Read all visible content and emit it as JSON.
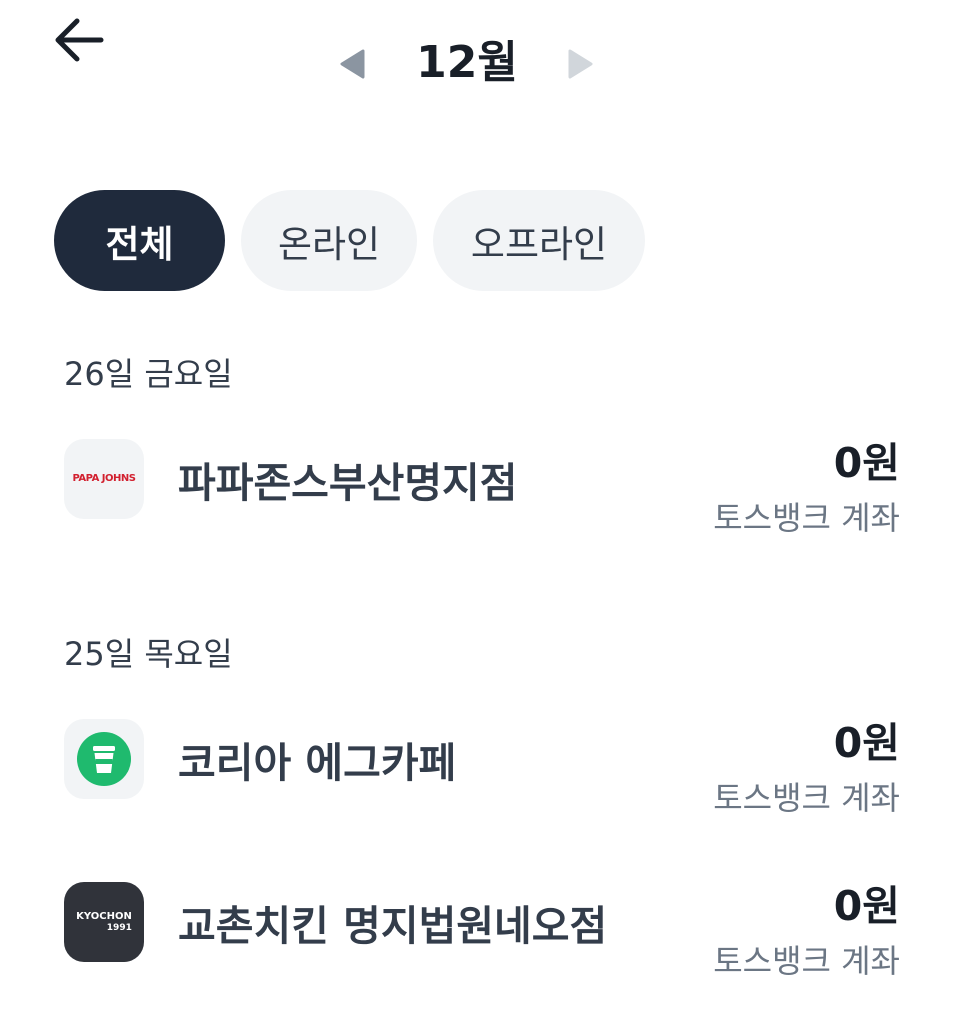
{
  "header": {
    "month_title": "12월"
  },
  "filters": {
    "all": "전체",
    "online": "온라인",
    "offline": "오프라인",
    "selected": "전체"
  },
  "groups": [
    {
      "date": "26일 금요일",
      "transactions": [
        {
          "merchant": "파파존스부산명지점",
          "amount": "0원",
          "account": "토스뱅크 계좌",
          "logo_icon": "papa-johns-logo",
          "logo_text": "PAPA JOHNS"
        }
      ]
    },
    {
      "date": "25일 목요일",
      "transactions": [
        {
          "merchant": "코리아 에그카페",
          "amount": "0원",
          "account": "토스뱅크 계좌",
          "logo_icon": "coffee-cup-icon"
        },
        {
          "merchant": "교촌치킨 명지법원네오점",
          "amount": "0원",
          "account": "토스뱅크 계좌",
          "logo_icon": "kyochon-logo",
          "logo_text": "KYOCHON",
          "logo_subtext": "1991"
        }
      ]
    }
  ],
  "colors": {
    "active_chip_bg": "#1f2a3c",
    "inactive_chip_bg": "#f2f4f6",
    "primary_text": "#191f28",
    "secondary_text": "#6b7684",
    "egg_cafe_green": "#1fba6e",
    "papa_red": "#d2202f",
    "kyochon_bg": "#30333a"
  }
}
